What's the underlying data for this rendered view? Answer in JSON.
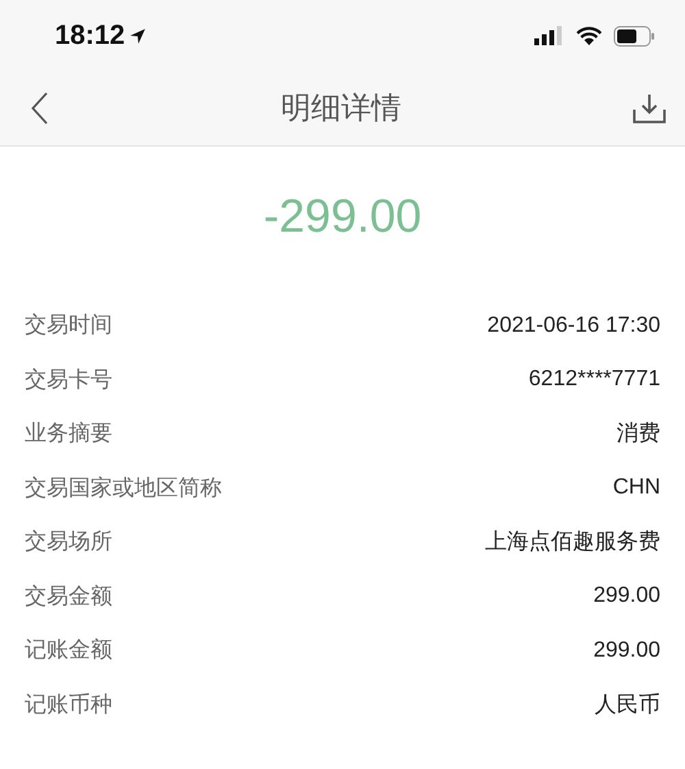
{
  "status_bar": {
    "time": "18:12"
  },
  "nav": {
    "title": "明细详情"
  },
  "amount": "-299.00",
  "details": [
    {
      "label": "交易时间",
      "value": "2021-06-16 17:30"
    },
    {
      "label": "交易卡号",
      "value": "6212****7771"
    },
    {
      "label": "业务摘要",
      "value": "消费"
    },
    {
      "label": "交易国家或地区简称",
      "value": "CHN"
    },
    {
      "label": "交易场所",
      "value": "上海点佰趣服务费"
    },
    {
      "label": "交易金额",
      "value": "299.00"
    },
    {
      "label": "记账金额",
      "value": "299.00"
    },
    {
      "label": "记账币种",
      "value": "人民币"
    }
  ]
}
